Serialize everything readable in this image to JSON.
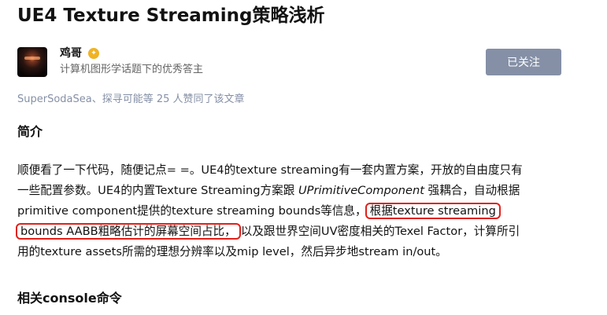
{
  "article": {
    "title": "UE4 Texture Streaming策略浅析"
  },
  "author": {
    "avatar_icon": "avatar-image",
    "name": "鸡哥",
    "badge_icon": "gold-badge-icon",
    "badge_glyph": "✦",
    "description": "计算机图形学话题下的优秀答主",
    "follow_label": "已关注"
  },
  "likes_line": "SuperSodaSea、探寻可能等 25 人赞同了该文章",
  "sections": {
    "intro_heading": "简介",
    "console_heading": "相关console命令"
  },
  "paragraph": {
    "l1": "顺便看了一下代码，随便记点= =。UE4的texture streaming有一套内置方案，开放的自由度只有",
    "l2_a": "一些配置参数。UE4的内置Texture Streaming方案跟 ",
    "l2_em": "UPrimitiveComponent",
    "l2_b": " 强耦合，自动根据",
    "l3_a": "primitive component提供的texture streaming bounds等信息，",
    "l3_hl": "根据texture streaming",
    "l4_hl": "bounds AABB粗略估计的屏幕空间占比，",
    "l4_b": "以及跟世界空间UV密度相关的Texel Factor，计算所引",
    "l5": "用的texture assets所需的理想分辨率以及mip level，然后异步地stream in/out。"
  },
  "colors": {
    "highlight_border": "#e0201a",
    "follow_button_bg": "#8590a6",
    "muted_text": "#8590a6"
  }
}
